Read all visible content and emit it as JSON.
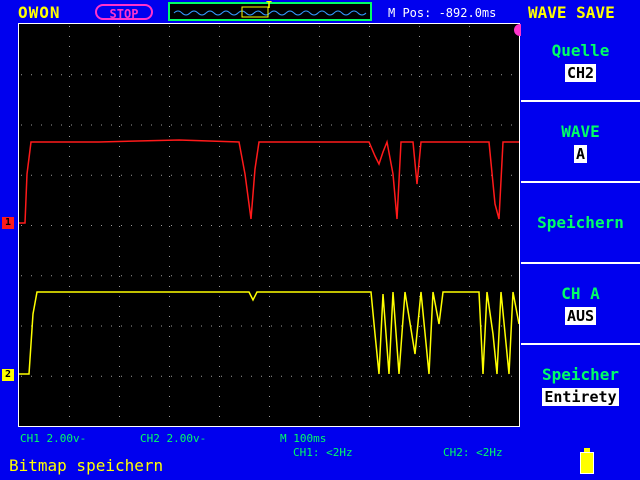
{
  "header": {
    "brand": "OWON",
    "run_state": "STOP",
    "timebase_position_label": "M Pos: -892.0ms",
    "trigger_marker": "T",
    "mode_title": "WAVE SAVE"
  },
  "menu": {
    "source": {
      "label": "Quelle",
      "value": "CH2"
    },
    "wave": {
      "label": "WAVE",
      "value": "A"
    },
    "save": {
      "label": "Speichern"
    },
    "ch_a": {
      "label": "CH A",
      "value": "AUS"
    },
    "storage": {
      "label": "Speicher",
      "value": "Entirety"
    }
  },
  "status": {
    "ch1_scale": "CH1 2.00v-",
    "ch2_scale": "CH2 2.00v-",
    "time_scale": "M  100ms",
    "ch1_freq": "CH1: <2Hz",
    "ch2_freq": "CH2: <2Hz"
  },
  "footer": {
    "message": "Bitmap speichern"
  },
  "markers": {
    "ch1": "1",
    "ch2": "2"
  },
  "colors": {
    "background": "#0000ee",
    "ch1_trace": "#ff1a1a",
    "ch2_trace": "#ffff00",
    "menu_text": "#00ff66",
    "stop_badge": "#ff33cc"
  }
}
